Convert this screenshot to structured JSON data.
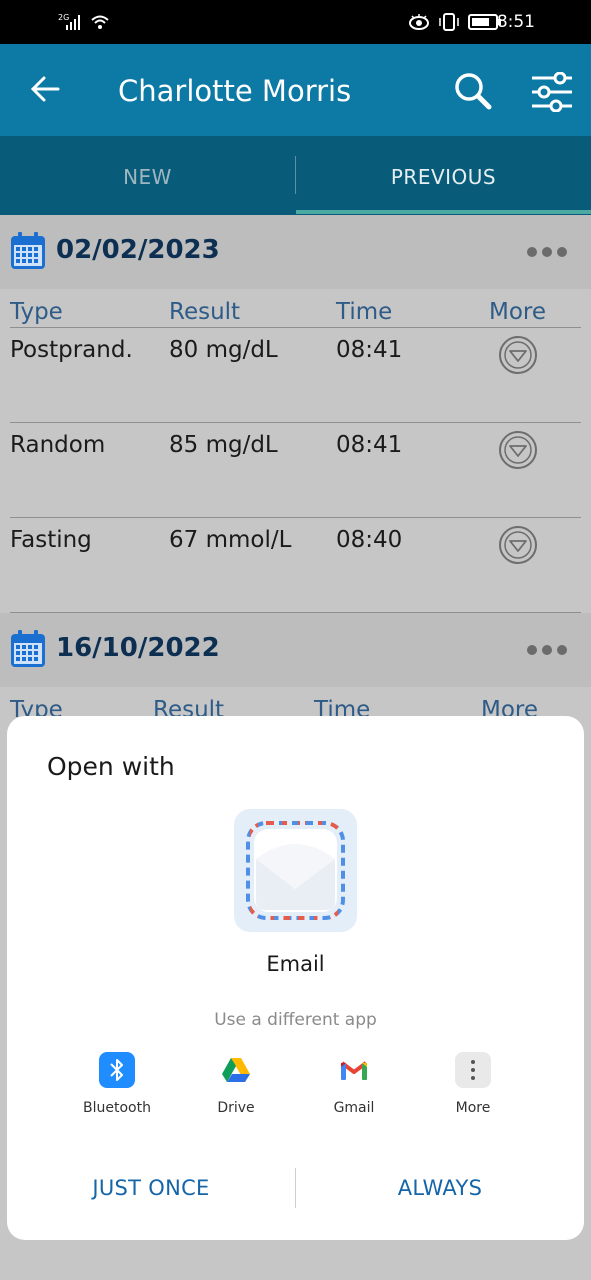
{
  "status_bar": {
    "network": "2G",
    "time": "8:51"
  },
  "app_bar": {
    "title": "Charlotte Morris",
    "icons": [
      "back-arrow-icon",
      "search-icon",
      "filter-sliders-icon"
    ]
  },
  "tabs": [
    {
      "label": "NEW",
      "selected": false
    },
    {
      "label": "PREVIOUS",
      "selected": true
    }
  ],
  "records": [
    {
      "date": "02/02/2023",
      "columns": [
        "Type",
        "Result",
        "Time",
        "More"
      ],
      "rows": [
        {
          "type": "Postprand.",
          "result": "80 mg/dL",
          "time": "08:41"
        },
        {
          "type": "Random",
          "result": "85 mg/dL",
          "time": "08:41"
        },
        {
          "type": "Fasting",
          "result": "67 mmol/L",
          "time": "08:40"
        }
      ]
    },
    {
      "date": "16/10/2022",
      "columns": [
        "Type",
        "Result",
        "Time",
        "More"
      ],
      "rows": []
    }
  ],
  "sheet": {
    "title": "Open with",
    "default_app": "Email",
    "different_app_label": "Use a different app",
    "apps": [
      {
        "label": "Bluetooth",
        "icon": "bluetooth-icon"
      },
      {
        "label": "Drive",
        "icon": "drive-icon"
      },
      {
        "label": "Gmail",
        "icon": "gmail-icon"
      },
      {
        "label": "More",
        "icon": "more-vert-icon"
      }
    ],
    "just_once": "JUST ONCE",
    "always": "ALWAYS"
  },
  "colors": {
    "app_bar": "#0c7aa4",
    "tabs": "#085c79",
    "accent_text": "#2e5b87",
    "button_text": "#1565a8"
  }
}
